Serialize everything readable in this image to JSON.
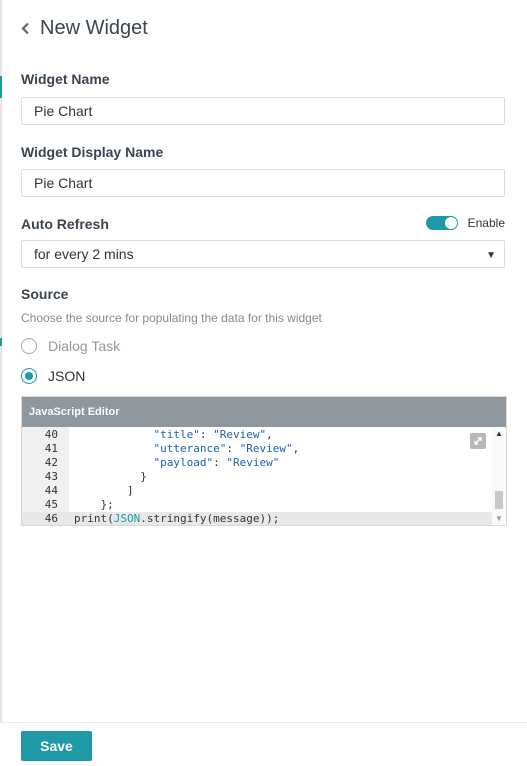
{
  "header": {
    "title": "New Widget",
    "back_icon": "chevron-left-icon"
  },
  "widget_name": {
    "label": "Widget Name",
    "value": "Pie Chart"
  },
  "display_name": {
    "label": "Widget Display Name",
    "value": "Pie Chart"
  },
  "auto_refresh": {
    "label": "Auto Refresh",
    "toggle_label": "Enable",
    "enabled": true,
    "selected": "for every 2 mins"
  },
  "source": {
    "label": "Source",
    "hint": "Choose the source for populating the data for this widget",
    "options": [
      {
        "label": "Dialog Task",
        "checked": false
      },
      {
        "label": "JSON",
        "checked": true
      }
    ]
  },
  "editor": {
    "title": "JavaScript Editor",
    "lines": [
      {
        "n": "40",
        "t": "            \"title\": \"Review\","
      },
      {
        "n": "41",
        "t": "            \"utterance\": \"Review\","
      },
      {
        "n": "42",
        "t": "            \"payload\": \"Review\""
      },
      {
        "n": "43",
        "t": "          }"
      },
      {
        "n": "44",
        "t": "        ]"
      },
      {
        "n": "45",
        "t": "    };"
      },
      {
        "n": "46",
        "t": "print(JSON.stringify(message));"
      }
    ]
  },
  "footer": {
    "save_label": "Save"
  },
  "colors": {
    "accent": "#1e9aa6",
    "editor_header": "#8e979e"
  }
}
